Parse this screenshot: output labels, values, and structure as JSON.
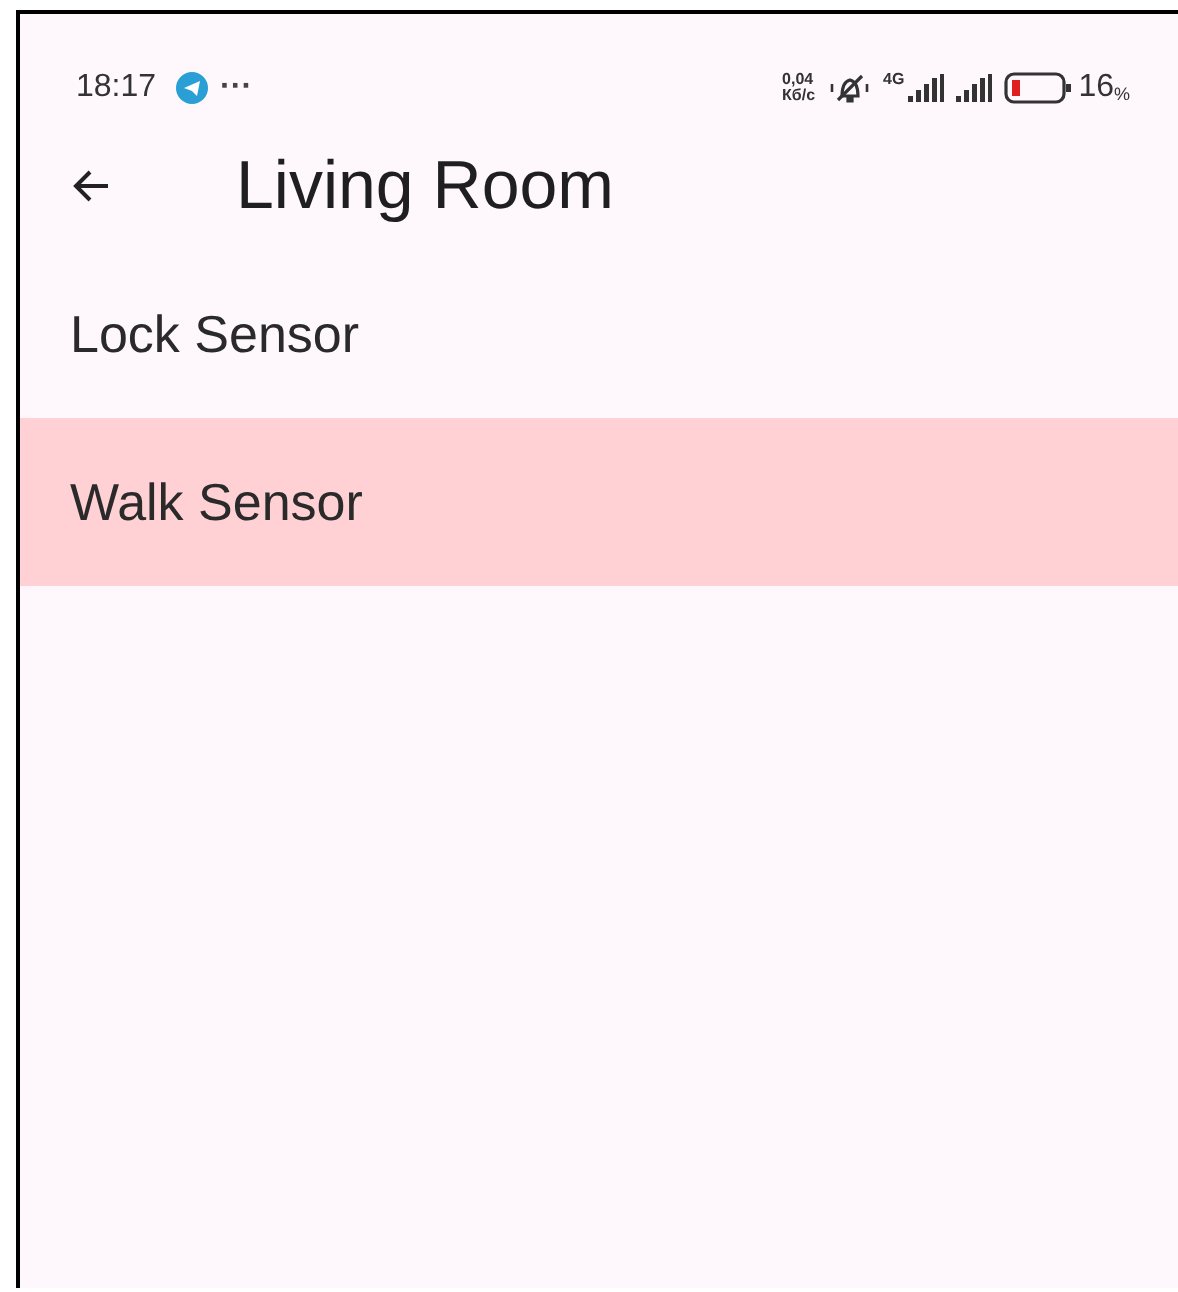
{
  "status_bar": {
    "time": "18:17",
    "more": "···",
    "speed": "0,04",
    "speed_unit": "Кб/с",
    "network": "4G",
    "battery": "16",
    "battery_unit": "%"
  },
  "app_bar": {
    "title": "Living Room"
  },
  "items": [
    {
      "label": "Lock Sensor",
      "selected": false
    },
    {
      "label": "Walk Sensor",
      "selected": true
    }
  ]
}
